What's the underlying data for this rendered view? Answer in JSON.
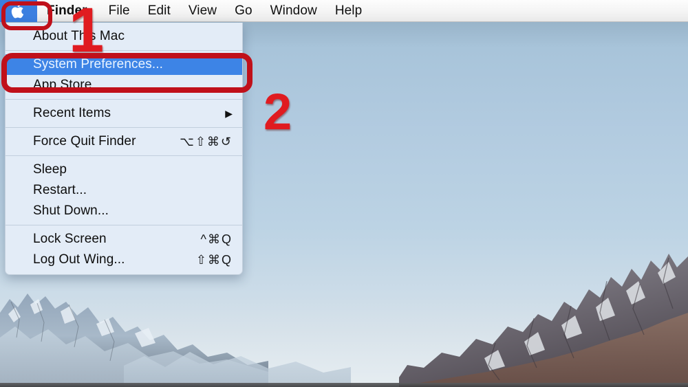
{
  "menubar": {
    "apple_icon": "apple-logo-icon",
    "items": [
      {
        "label": "Finder",
        "bold": true
      },
      {
        "label": "File",
        "bold": false
      },
      {
        "label": "Edit",
        "bold": false
      },
      {
        "label": "View",
        "bold": false
      },
      {
        "label": "Go",
        "bold": false
      },
      {
        "label": "Window",
        "bold": false
      },
      {
        "label": "Help",
        "bold": false
      }
    ]
  },
  "apple_menu": {
    "rows": [
      {
        "label": "About This Mac",
        "accel": "",
        "arrow": "",
        "selected": false
      },
      {
        "sep": true
      },
      {
        "label": "System Preferences...",
        "accel": "",
        "arrow": "",
        "selected": true
      },
      {
        "label": "App Store",
        "accel": "",
        "arrow": "",
        "selected": false
      },
      {
        "sep": true
      },
      {
        "label": "Recent Items",
        "accel": "",
        "arrow": "▶",
        "selected": false
      },
      {
        "sep": true
      },
      {
        "label": "Force Quit Finder",
        "accel": "⌥⇧⌘↺",
        "arrow": "",
        "selected": false
      },
      {
        "sep": true
      },
      {
        "label": "Sleep",
        "accel": "",
        "arrow": "",
        "selected": false
      },
      {
        "label": "Restart...",
        "accel": "",
        "arrow": "",
        "selected": false
      },
      {
        "label": "Shut Down...",
        "accel": "",
        "arrow": "",
        "selected": false
      },
      {
        "sep": true
      },
      {
        "label": "Lock Screen",
        "accel": "^⌘Q",
        "arrow": "",
        "selected": false
      },
      {
        "label": "Log Out Wing...",
        "accel": "⇧⌘Q",
        "arrow": "",
        "selected": false
      }
    ]
  },
  "annotations": {
    "step1_number": "1",
    "step2_number": "2",
    "highlight_color": "#c0101a",
    "number_color": "#e01b20"
  },
  "colors": {
    "menu_background": "#e3ecf7",
    "selection_blue": "#3d84e6",
    "menubar_background": "#f4f4f4",
    "sky_top": "#7e99ad",
    "sky_bottom": "#e6edf1"
  }
}
